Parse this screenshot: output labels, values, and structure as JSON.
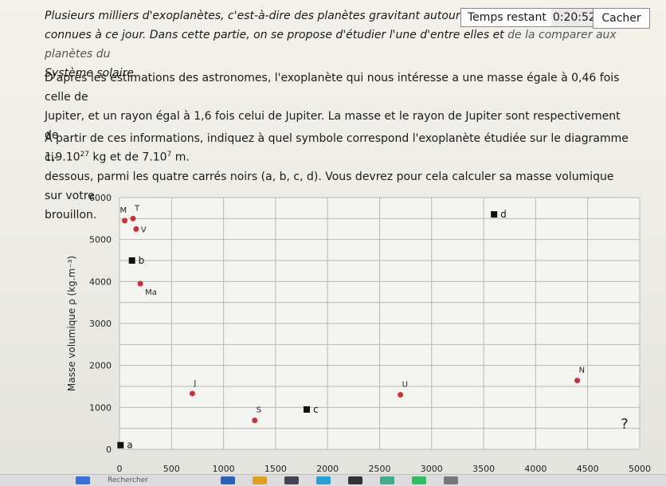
{
  "intro": {
    "italic_text": "Plusieurs milliers d'exoplanètes, c'est-à-dire des planètes gravitant autour d'une a",
    "italic_text_2": "connues à ce jour. Dans cette partie, on se propose d'étudier l'une d'entre elles et",
    "italic_text_hidden": "de la comparer aux planètes du",
    "italic_text_3": "Système solaire."
  },
  "paragraph2": {
    "line1": "D'après les estimations des astronomes, l'exoplanète qui nous intéresse a une masse égale à 0,46 fois celle de",
    "line2": "Jupiter, et un rayon égal à 1,6 fois celui de Jupiter. La masse et le rayon de Jupiter sont respectivement de",
    "mass_value": "1,9.10",
    "mass_exp": "27",
    "mass_unit": " kg et de ",
    "radius_value": "7.10",
    "radius_exp": "7",
    "radius_unit": " m."
  },
  "paragraph3": {
    "line1": "À partir de ces informations, indiquez à quel symbole correspond l'exoplanète étudiée sur le diagramme ci-",
    "line2": "dessous, parmi les quatre carrés noirs (a, b, c, d). Vous devrez pour cela calculer sa masse volumique sur votre",
    "line3": "brouillon."
  },
  "timer": {
    "label": "Temps restant",
    "value": "0:20:52"
  },
  "hide_button_label": "Cacher",
  "help_symbol": "?",
  "taskbar": {
    "search_label": "Rechercher"
  },
  "colors": {
    "planet_dot": "#c8323a",
    "square": "#111111",
    "grid": "#b8b8b8"
  },
  "chart_data": {
    "type": "scatter",
    "ylabel": "Masse volumique ρ (kg.m⁻³)",
    "xlabel": "",
    "ylim": [
      0,
      6000
    ],
    "xlim": [
      0,
      5000
    ],
    "y_ticks": [
      "0",
      "1000",
      "2000",
      "3000",
      "4000",
      "5000",
      "6000"
    ],
    "x_ticks": [
      "0",
      "500",
      "1000",
      "1500",
      "2000",
      "2500",
      "3000",
      "3500",
      "4000",
      "4500",
      "5000"
    ],
    "grid": true,
    "planets": [
      {
        "label": "M",
        "x": 50,
        "y": 5450
      },
      {
        "label": "T",
        "x": 130,
        "y": 5500
      },
      {
        "label": "V",
        "x": 160,
        "y": 5250
      },
      {
        "label": "Ma",
        "x": 200,
        "y": 3950
      },
      {
        "label": "J",
        "x": 700,
        "y": 1330
      },
      {
        "label": "S",
        "x": 1300,
        "y": 690
      },
      {
        "label": "U",
        "x": 2700,
        "y": 1300
      },
      {
        "label": "N",
        "x": 4400,
        "y": 1640
      }
    ],
    "squares": [
      {
        "label": "a",
        "x": 10,
        "y": 100
      },
      {
        "label": "b",
        "x": 120,
        "y": 4500
      },
      {
        "label": "c",
        "x": 1800,
        "y": 950
      },
      {
        "label": "d",
        "x": 3600,
        "y": 5600
      }
    ]
  }
}
